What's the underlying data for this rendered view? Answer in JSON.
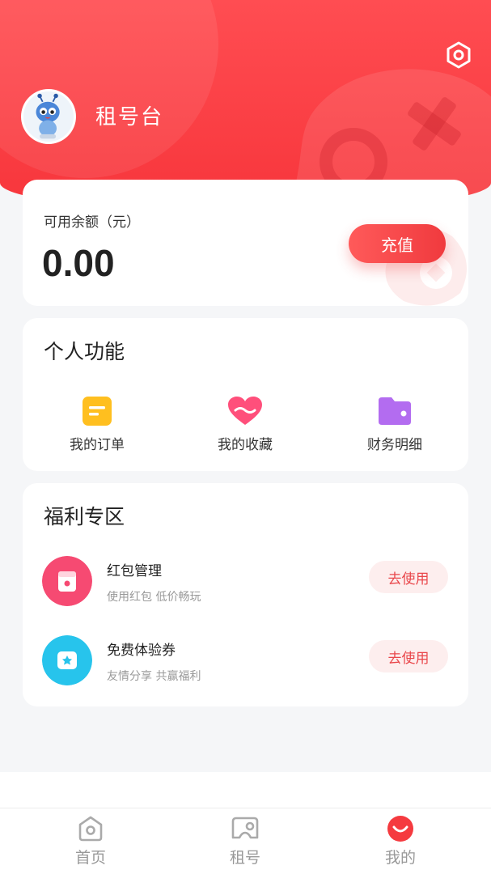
{
  "header": {
    "username": "租号台",
    "settings_icon": "settings-icon",
    "avatar_icon": "bee-mascot-avatar",
    "accent_color": "#f7353b"
  },
  "balance": {
    "label": "可用余额（元）",
    "value": "0.00",
    "recharge_label": "充值"
  },
  "personal": {
    "title": "个人功能",
    "items": [
      {
        "label": "我的订单",
        "icon": "order-icon",
        "color": "#ffbf1f"
      },
      {
        "label": "我的收藏",
        "icon": "heart-icon",
        "color": "#ff4f7b"
      },
      {
        "label": "财务明细",
        "icon": "wallet-icon",
        "color": "#b36cf0"
      }
    ]
  },
  "welfare": {
    "title": "福利专区",
    "items": [
      {
        "title": "红包管理",
        "subtitle": "使用红包 低价畅玩",
        "button": "去使用",
        "icon": "red-packet-icon",
        "color": "#f64a72"
      },
      {
        "title": "免费体验券",
        "subtitle": "友情分享 共赢福利",
        "button": "去使用",
        "icon": "coupon-icon",
        "color": "#27c4ec"
      }
    ]
  },
  "nav": {
    "items": [
      {
        "label": "首页",
        "icon": "home-icon",
        "active": false
      },
      {
        "label": "租号",
        "icon": "rent-icon",
        "active": false
      },
      {
        "label": "我的",
        "icon": "profile-smile-icon",
        "active": true
      }
    ],
    "active_color": "#f53a3f"
  }
}
